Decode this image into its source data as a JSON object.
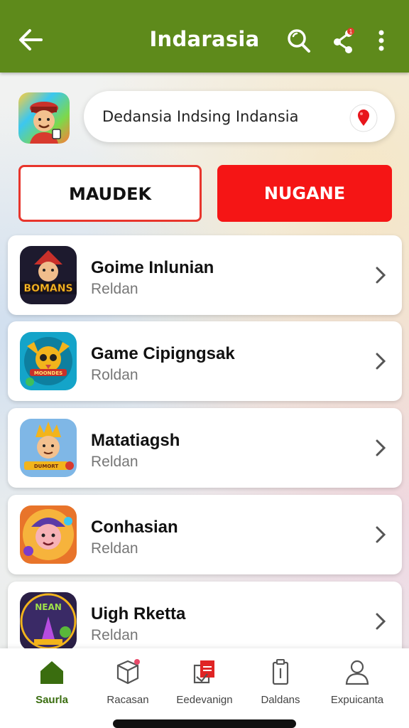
{
  "topbar": {
    "title": "Indarasia",
    "back_icon": "arrow-left-icon",
    "actions": [
      "search-icon",
      "share-icon",
      "more-vertical-icon"
    ],
    "share_badge": "1",
    "color": "#5e8a1b"
  },
  "header": {
    "search_text": "Dedansia Indsing Indansia",
    "pin_icon": "map-pin-icon"
  },
  "buttons": {
    "left_label": "MAUDEK",
    "right_label": "NUGANE",
    "accent": "#f51515"
  },
  "list": [
    {
      "title": "Goime Inlunian",
      "subtitle": "Reldan",
      "thumb_text": "BOMANS"
    },
    {
      "title": "Game Cipigngsak",
      "subtitle": "Roldan",
      "thumb_text": "MOONDES"
    },
    {
      "title": "Matatiagsh",
      "subtitle": "Reldan",
      "thumb_text": "DUMORT"
    },
    {
      "title": "Conhasian",
      "subtitle": "Reldan",
      "thumb_text": ""
    },
    {
      "title": "Uigh Rketta",
      "subtitle": "Reldan",
      "thumb_text": "NEAN"
    }
  ],
  "bottom_nav": [
    {
      "label": "Saurla",
      "icon": "home-icon",
      "active": true
    },
    {
      "label": "Racasan",
      "icon": "box-icon",
      "active": false
    },
    {
      "label": "Eedevanign",
      "icon": "documents-icon",
      "active": false
    },
    {
      "label": "Daldans",
      "icon": "clipboard-icon",
      "active": false
    },
    {
      "label": "Expuicanta",
      "icon": "person-icon",
      "active": false
    }
  ]
}
